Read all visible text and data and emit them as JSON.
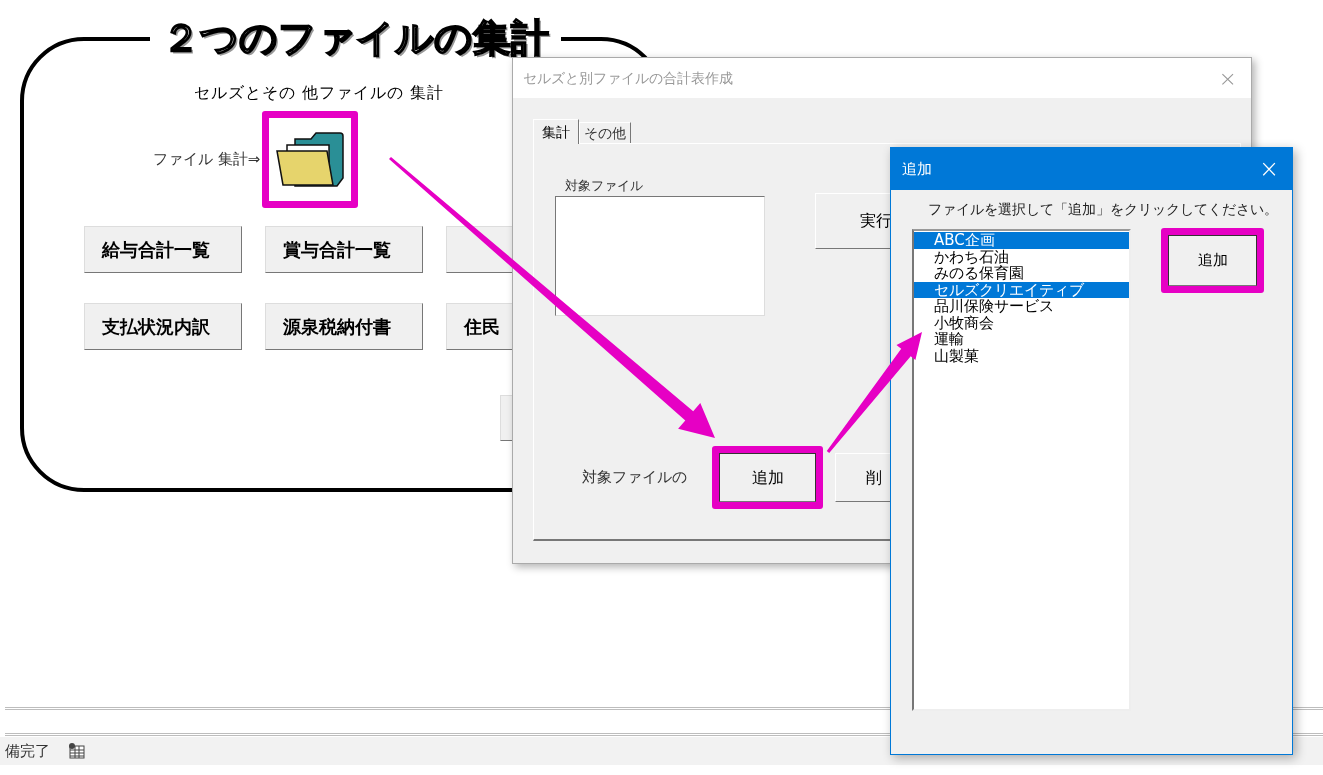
{
  "sheet": {
    "title": "２つのファイルの集計",
    "subtitle": "セルズとその 他ファイルの 集計",
    "file_label": "ファイル 集計⇒",
    "folder_highlighted": true,
    "button_rows": [
      [
        {
          "label": "給与合計一覧"
        },
        {
          "label": "賞与合計一覧"
        },
        {}
      ],
      [
        {
          "label": "支払状況内訳"
        },
        {
          "label": "源泉税納付書"
        },
        {
          "label": "住民"
        }
      ]
    ]
  },
  "dialog": {
    "title": "セルズと別ファイルの合計表作成",
    "close": "×",
    "tabs": [
      {
        "label": "集計",
        "selected": true
      },
      {
        "label": "その他",
        "selected": false
      }
    ],
    "list_label": "対象ファイル",
    "run_button": "実行",
    "row_label": "対象ファイルの",
    "add_button": {
      "label": "追加",
      "highlighted": true
    },
    "delete_button": "削"
  },
  "add_dialog": {
    "title": "追加",
    "close": "×",
    "instruction": "ファイルを選択して「追加」をクリックしてください。",
    "items": [
      {
        "label": "ABC企画",
        "selected": true
      },
      {
        "label": "かわち石油",
        "selected": false
      },
      {
        "label": "みのる保育園",
        "selected": false
      },
      {
        "label": "セルズクリエイティブ",
        "selected": true
      },
      {
        "label": "品川保険サービス",
        "selected": false
      },
      {
        "label": "小牧商会",
        "selected": false
      },
      {
        "label": "運輸",
        "selected": false
      },
      {
        "label": "山製菓",
        "selected": false
      }
    ],
    "add_button": {
      "label": "追加",
      "highlighted": true
    }
  },
  "status_bar": {
    "text": "備完了"
  }
}
